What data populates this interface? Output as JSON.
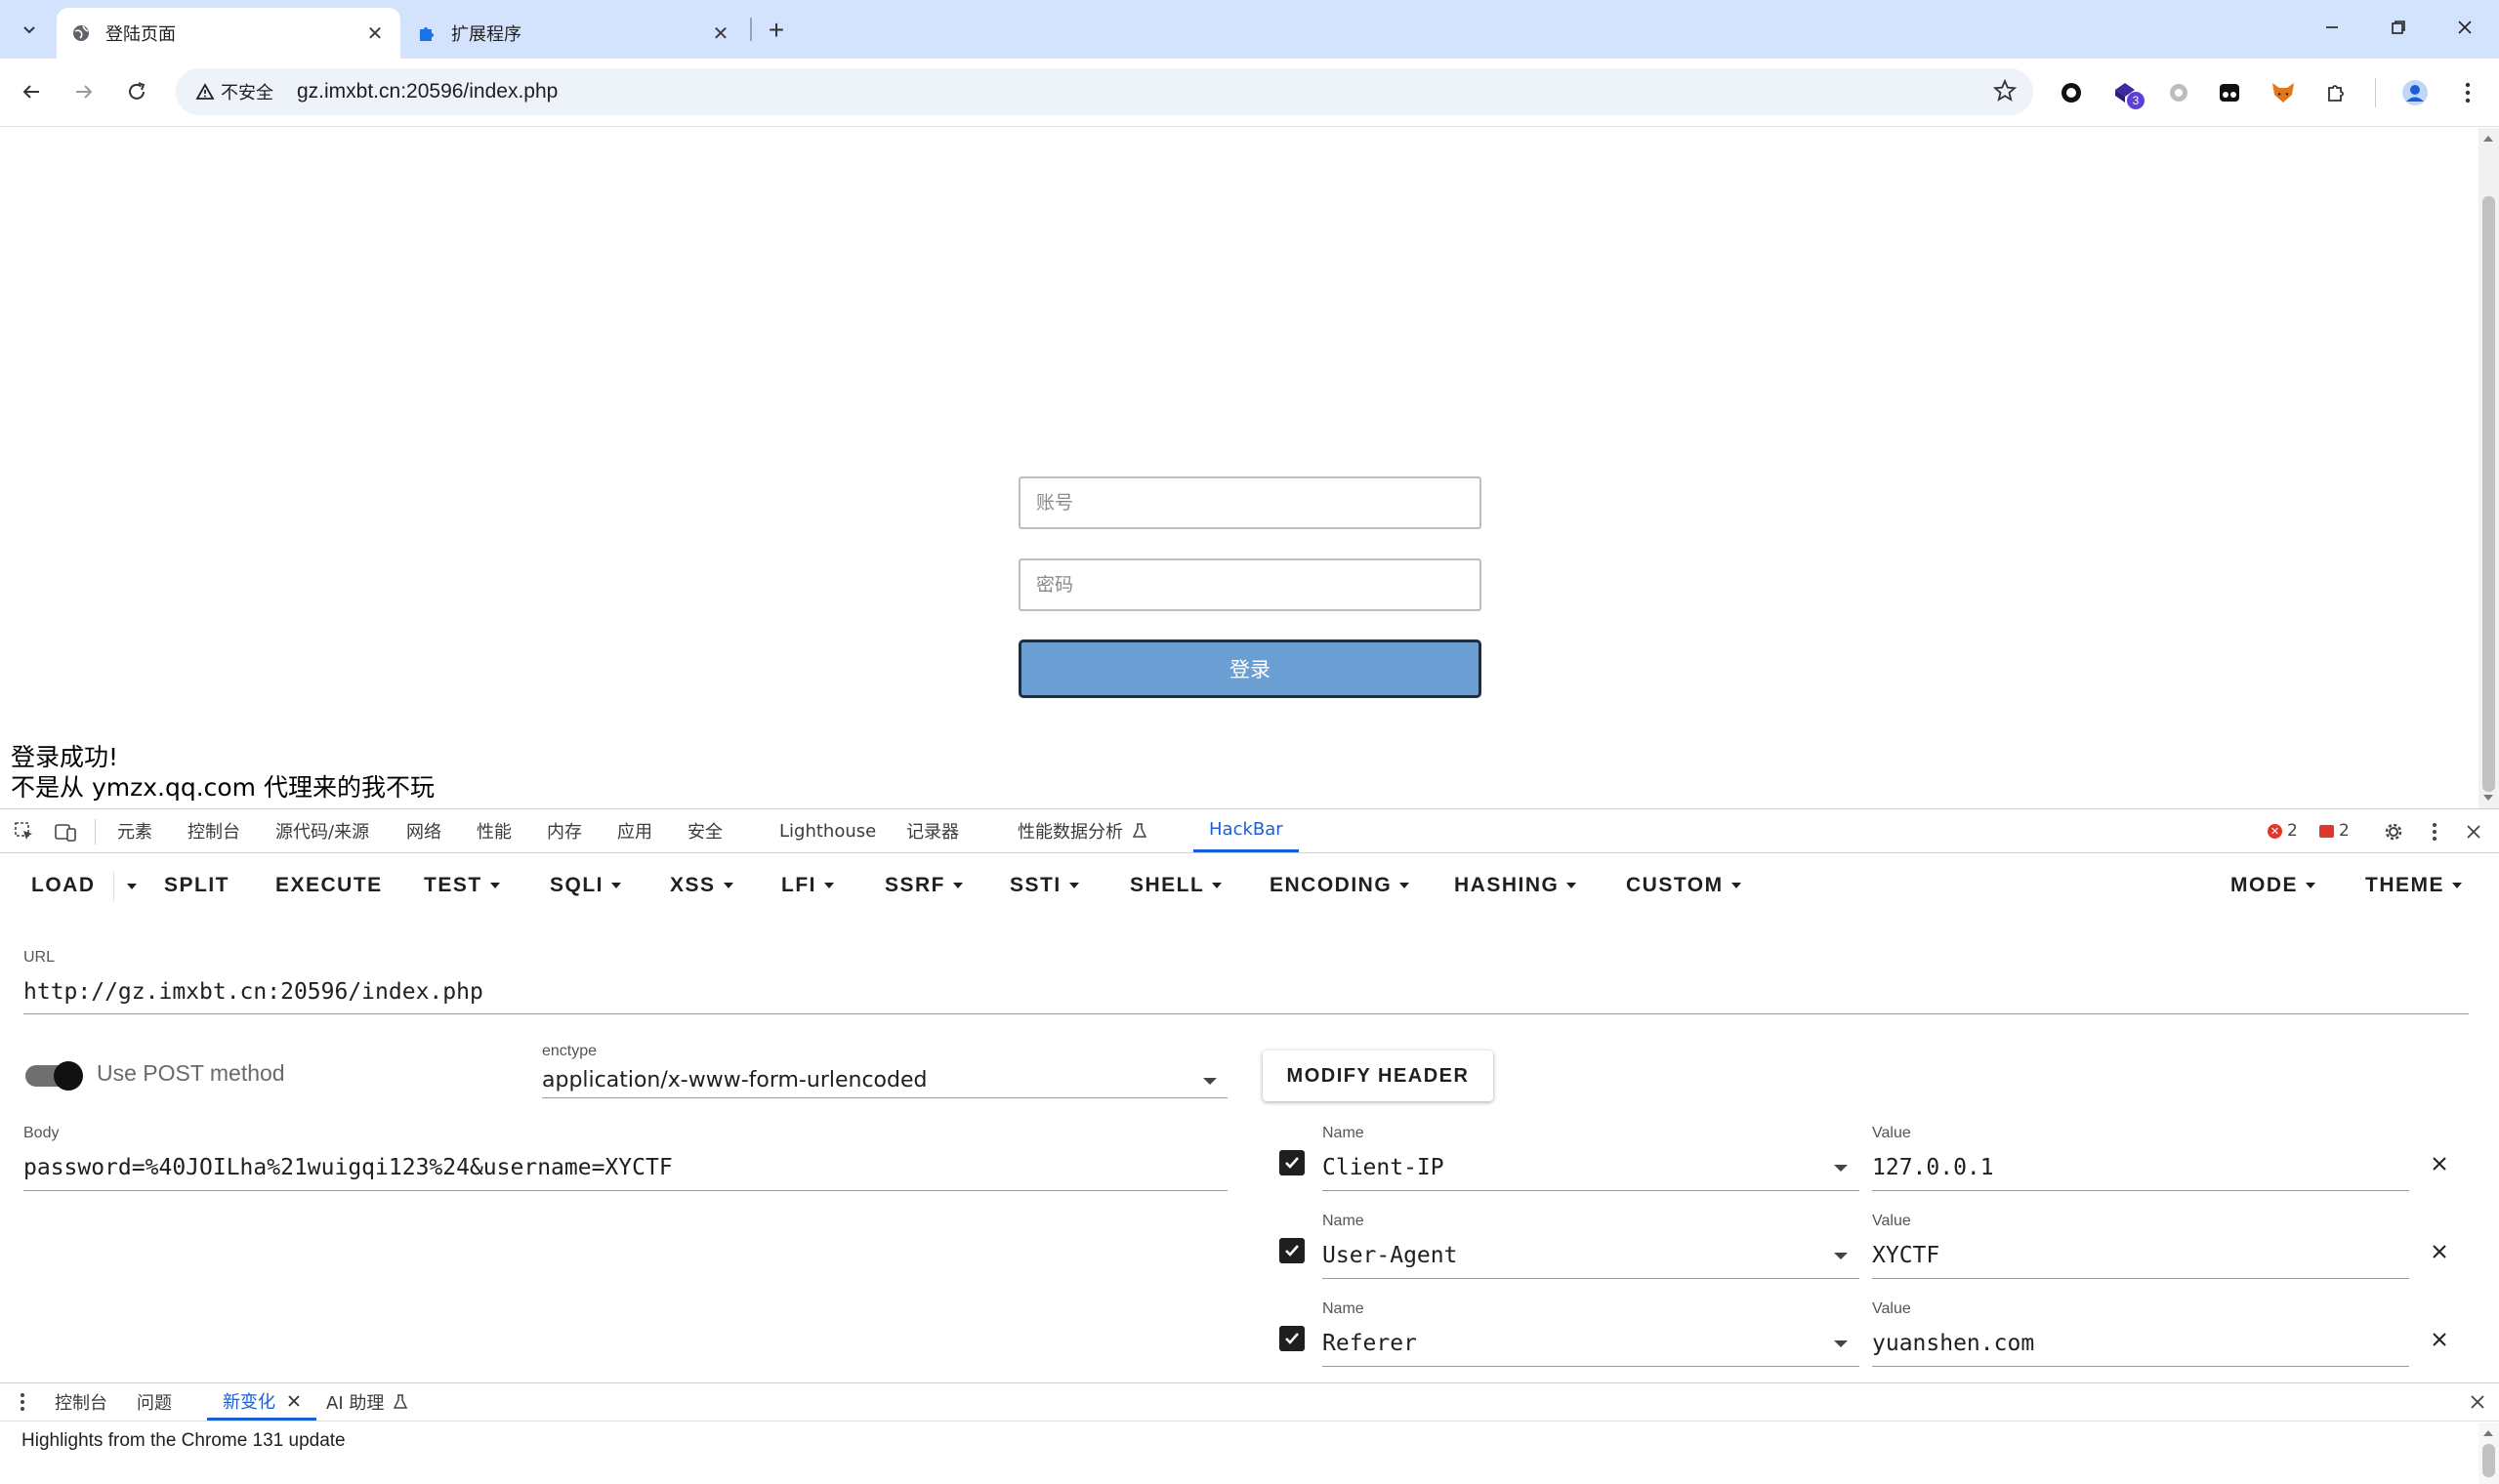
{
  "browser": {
    "tabs": [
      {
        "title": "登陆页面",
        "active": true
      },
      {
        "title": "扩展程序",
        "active": false
      }
    ],
    "address": {
      "security_label": "不安全",
      "url": "gz.imxbt.cn:20596/index.php"
    },
    "extension_badge": "3"
  },
  "page": {
    "username_placeholder": "账号",
    "password_placeholder": "密码",
    "login_button": "登录",
    "messages": [
      "登录成功!",
      "不是从 ymzx.qq.com 代理来的我不玩"
    ]
  },
  "devtools": {
    "tabs": [
      "元素",
      "控制台",
      "源代码/来源",
      "网络",
      "性能",
      "内存",
      "应用",
      "安全",
      "Lighthouse",
      "记录器",
      "性能数据分析",
      "HackBar"
    ],
    "active_tab": "HackBar",
    "error_count": "2",
    "issue_count": "2"
  },
  "hackbar": {
    "menu": [
      "LOAD",
      "SPLIT",
      "EXECUTE",
      "TEST",
      "SQLI",
      "XSS",
      "LFI",
      "SSRF",
      "SSTI",
      "SHELL",
      "ENCODING",
      "HASHING",
      "CUSTOM",
      "MODE",
      "THEME"
    ],
    "url_label": "URL",
    "url": "http://gz.imxbt.cn:20596/index.php",
    "post_toggle_label": "Use POST method",
    "post_enabled": true,
    "enctype_label": "enctype",
    "enctype": "application/x-www-form-urlencoded",
    "body_label": "Body",
    "body": "password=%40JOILha%21wuigqi123%24&username=XYCTF",
    "modify_header_button": "MODIFY HEADER",
    "header_name_label": "Name",
    "header_value_label": "Value",
    "headers": [
      {
        "name": "Client-IP",
        "value": "127.0.0.1",
        "enabled": true
      },
      {
        "name": "User-Agent",
        "value": "XYCTF",
        "enabled": true
      },
      {
        "name": "Referer",
        "value": "yuanshen.com",
        "enabled": true
      }
    ]
  },
  "drawer": {
    "tabs": [
      "控制台",
      "问题",
      "新变化",
      "AI 助理"
    ],
    "active_tab": "新变化",
    "content": "Highlights from the Chrome 131 update"
  },
  "colors": {
    "tabbar_bg": "#d3e3fd",
    "accent": "#1a5fd6",
    "login_button_bg": "#6b9fd4"
  }
}
